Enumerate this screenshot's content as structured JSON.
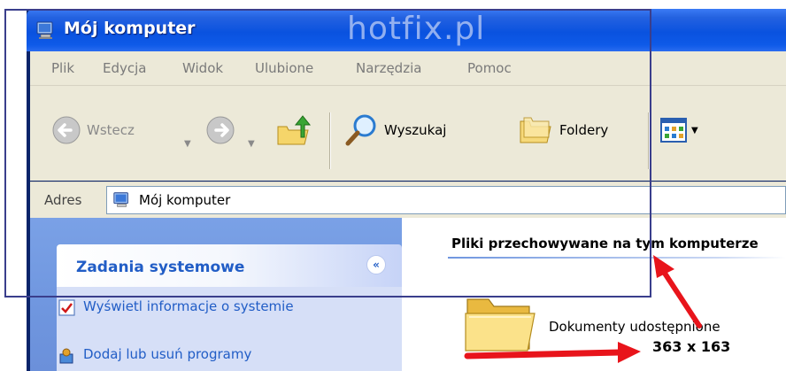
{
  "window": {
    "title": "Mój komputer",
    "watermark": "hotfix.pl"
  },
  "menu": {
    "items": [
      "Plik",
      "Edycja",
      "Widok",
      "Ulubione",
      "Narzędzia",
      "Pomoc"
    ]
  },
  "toolbar": {
    "back_label": "Wstecz",
    "search_label": "Wyszukaj",
    "folders_label": "Foldery"
  },
  "address": {
    "label": "Adres",
    "value": "Mój komputer"
  },
  "tasks": {
    "title": "Zadania systemowe",
    "items": [
      "Wyświetl informacje o systemie",
      "Dodaj lub usuń programy"
    ]
  },
  "content": {
    "group_title": "Pliki przechowywane na tym komputerze",
    "folder_label": "Dokumenty udostępnione"
  },
  "annotation": {
    "dimensions": "363 x 163"
  },
  "colors": {
    "titlebar": "#0a52df",
    "link_blue": "#215dc6",
    "annotation_red": "#e8141b",
    "frame": "#3a3e8c"
  }
}
